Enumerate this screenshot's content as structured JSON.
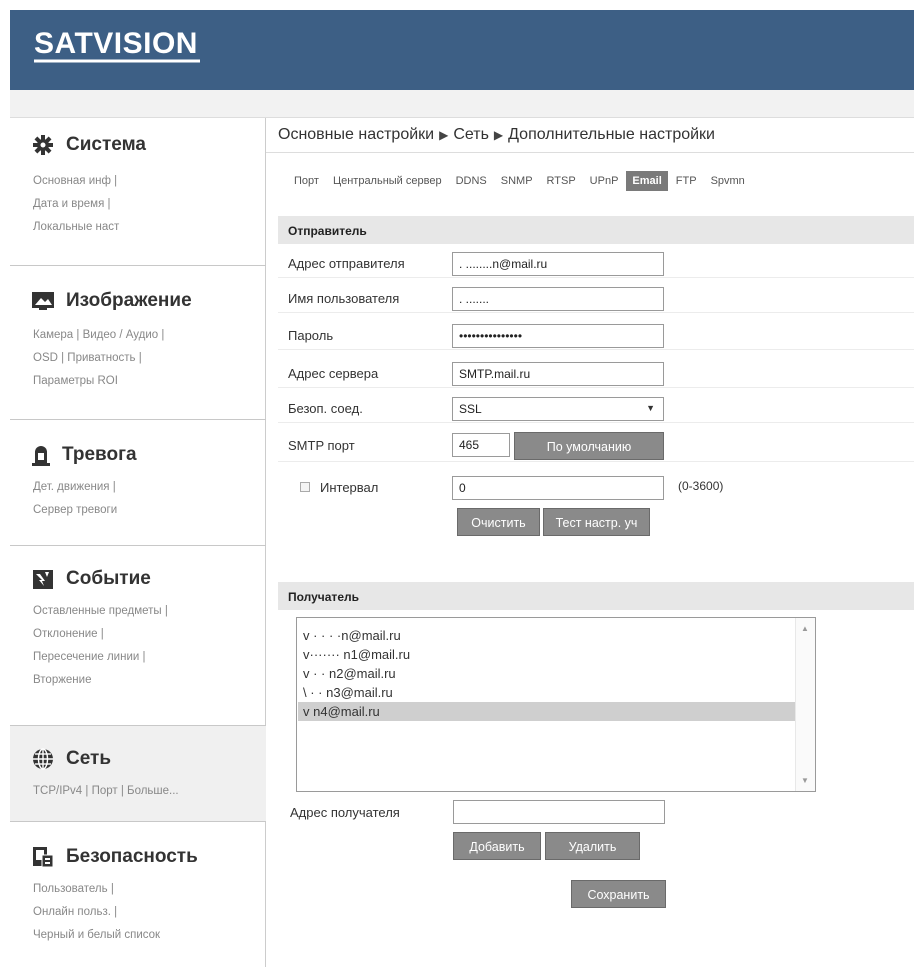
{
  "header": {
    "logo_text": "SATVISION",
    "colors": {
      "header_bg": "#3d5f85",
      "button_bg": "#8a8a8a"
    }
  },
  "sidebar": {
    "sections": [
      {
        "title": "Система",
        "icon": "gear-icon",
        "links": [
          "Основная инф |",
          "Дата и время |",
          "Локальные наст"
        ]
      },
      {
        "title": "Изображение",
        "icon": "image-icon",
        "links": [
          "Камера | Видео / Аудио |",
          "OSD | Приватность |",
          "Параметры ROI"
        ]
      },
      {
        "title": "Тревога",
        "icon": "alarm-icon",
        "links": [
          "Дет. движения |",
          "Сервер тревоги"
        ]
      },
      {
        "title": "Событие",
        "icon": "event-icon",
        "links": [
          "Оставленные предметы |",
          "Отклонение |",
          "Пересечение линии |",
          "Вторжение"
        ]
      },
      {
        "title": "Сеть",
        "icon": "globe-icon",
        "links": [
          "TCP/IPv4 | Порт | Больше..."
        ]
      },
      {
        "title": "Безопасность",
        "icon": "security-icon",
        "links": [
          "Пользователь |",
          "Онлайн польз. |",
          "Черный и белый список"
        ]
      }
    ]
  },
  "breadcrumb": {
    "items": [
      "Основные настройки",
      "Сеть",
      "Дополнительные настройки"
    ],
    "separator": "▶"
  },
  "tabs": [
    "Порт",
    "Центральный сервер",
    "DDNS",
    "SNMP",
    "RTSP",
    "UPnP",
    "Email",
    "FTP",
    "Spvmn"
  ],
  "active_tab": "Email",
  "sender": {
    "title": "Отправитель",
    "address_label": "Адрес отправителя",
    "address_value": ". ........n@mail.ru",
    "username_label": "Имя пользователя",
    "username_value": ". .......",
    "password_label": "Пароль",
    "password_value": "•••••••••••••••",
    "server_label": "Адрес сервера",
    "server_value": "SMTP.mail.ru",
    "secure_label": "Безоп. соед.",
    "secure_value": "SSL",
    "port_label": "SMTP порт",
    "port_value": "465",
    "default_button": "По умолчанию",
    "interval_label": "Интервал",
    "interval_value": "0",
    "interval_range": "(0-3600)",
    "clear_button": "Очистить",
    "test_button": "Тест настр. уч"
  },
  "receiver": {
    "title": "Получатель",
    "items": [
      "v  ·  ·  ·  ·n@mail.ru",
      "v·······  n1@mail.ru",
      "v   ·  ·  n2@mail.ru",
      "\\   ·  ·  n3@mail.ru",
      "v            n4@mail.ru"
    ],
    "selected_index": 4,
    "address_label": "Адрес получателя",
    "address_value": "",
    "add_button": "Добавить",
    "delete_button": "Удалить"
  },
  "save_button": "Сохранить"
}
